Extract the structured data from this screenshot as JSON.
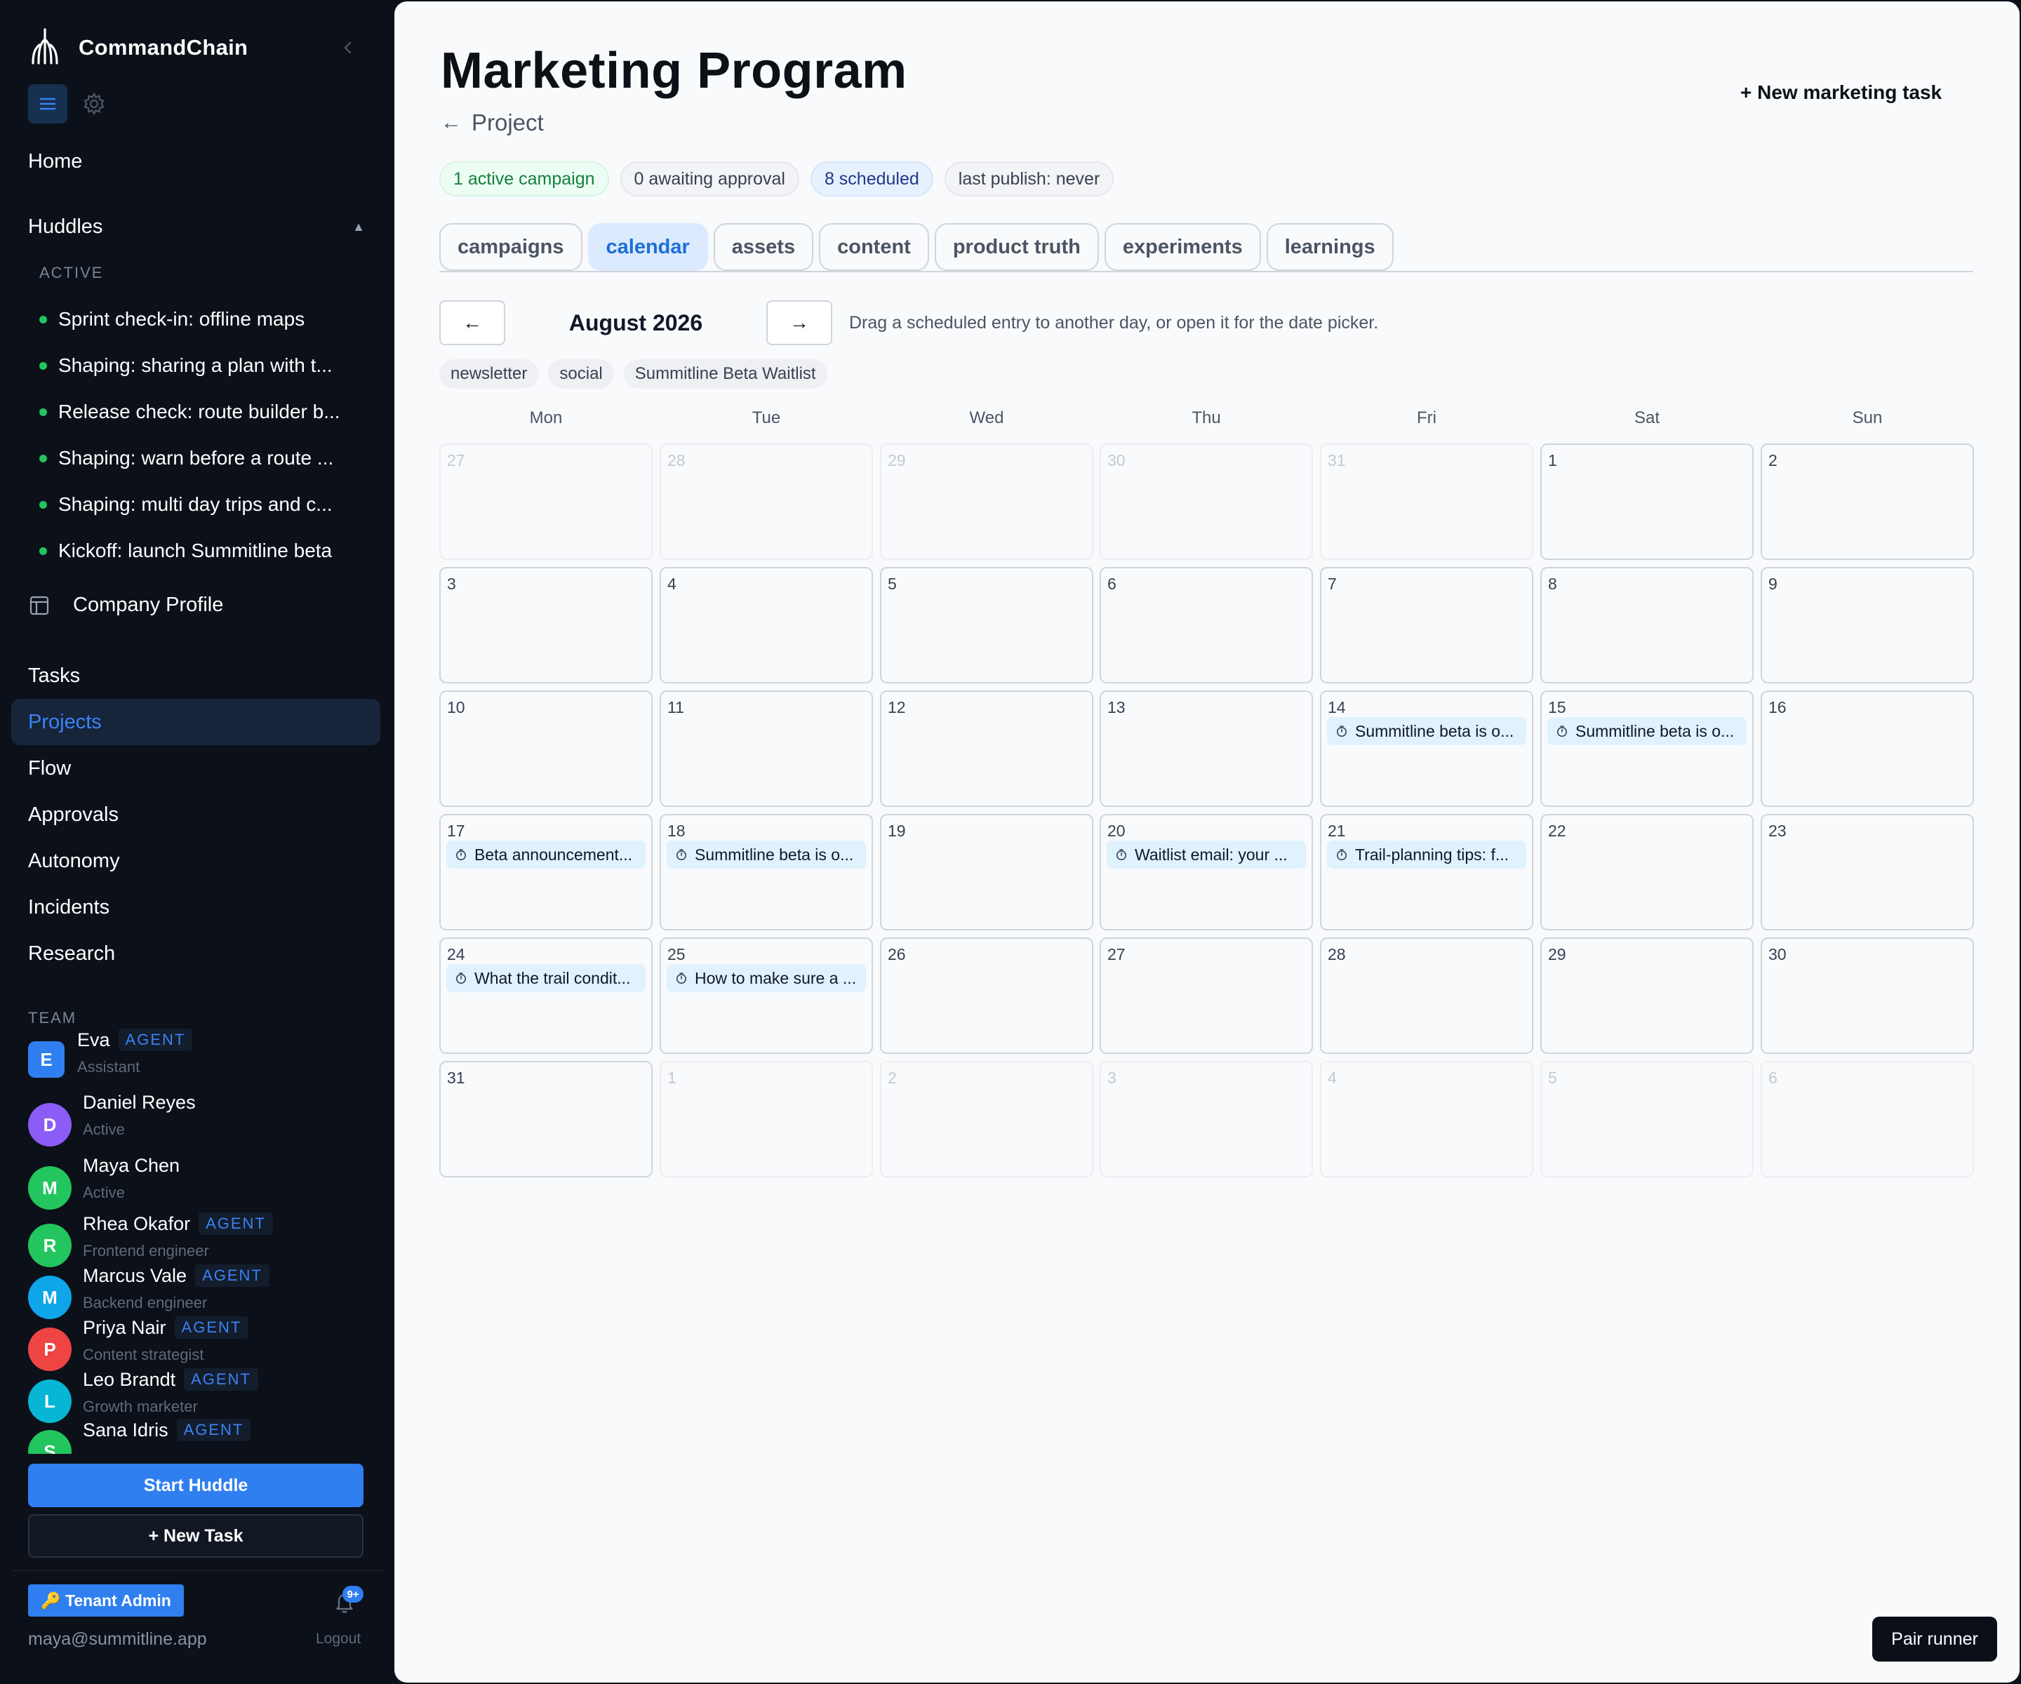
{
  "sidebar": {
    "brand": "CommandChain",
    "nav_home": "Home",
    "huddles_label": "Huddles",
    "huddles_active_label": "ACTIVE",
    "huddles": [
      "Sprint check-in: offline maps",
      "Shaping: sharing a plan with t...",
      "Release check: route builder b...",
      "Shaping: warn before a route ...",
      "Shaping: multi day trips and c...",
      "Kickoff: launch Summitline beta"
    ],
    "company_profile": "Company Profile",
    "nav": [
      "Tasks",
      "Projects",
      "Flow",
      "Approvals",
      "Autonomy",
      "Incidents",
      "Research"
    ],
    "active_nav": "Projects",
    "team_label": "TEAM",
    "team": [
      {
        "initial": "E",
        "name": "Eva",
        "agent": "AGENT",
        "role": "Assistant",
        "color": "#2f7ff0"
      },
      {
        "initial": "D",
        "name": "Daniel Reyes",
        "agent": "",
        "role": "Active",
        "color": "#8b5cf6"
      },
      {
        "initial": "M",
        "name": "Maya Chen",
        "agent": "",
        "role": "Active",
        "color": "#22c55e"
      },
      {
        "initial": "R",
        "name": "Rhea Okafor",
        "agent": "AGENT",
        "role": "Frontend engineer",
        "color": "#22c55e"
      },
      {
        "initial": "M",
        "name": "Marcus Vale",
        "agent": "AGENT",
        "role": "Backend engineer",
        "color": "#0ea5e9"
      },
      {
        "initial": "P",
        "name": "Priya Nair",
        "agent": "AGENT",
        "role": "Content strategist",
        "color": "#ef4444"
      },
      {
        "initial": "L",
        "name": "Leo Brandt",
        "agent": "AGENT",
        "role": "Growth marketer",
        "color": "#06b6d4"
      },
      {
        "initial": "S",
        "name": "Sana Idris",
        "agent": "AGENT",
        "role": "",
        "color": "#22c55e"
      }
    ],
    "start_huddle": "Start Huddle",
    "new_task": "+ New Task",
    "tenant_badge": "🔑 Tenant Admin",
    "notification_count": "9+",
    "user_email": "maya@summitline.app",
    "logout": "Logout"
  },
  "main": {
    "title": "Marketing Program",
    "back_label": "Project",
    "back_arrow": "←",
    "new_task": "+ New marketing task",
    "status_pills": [
      {
        "label": "1 active campaign",
        "tone": "green"
      },
      {
        "label": "0 awaiting approval",
        "tone": "gray"
      },
      {
        "label": "8 scheduled",
        "tone": "blue"
      },
      {
        "label": "last publish: never",
        "tone": "gray"
      }
    ],
    "tabs": [
      "campaigns",
      "calendar",
      "assets",
      "content",
      "product truth",
      "experiments",
      "learnings"
    ],
    "active_tab": "calendar",
    "calendar": {
      "prev": "←",
      "next": "→",
      "month": "August 2026",
      "hint": "Drag a scheduled entry to another day, or open it for the date picker.",
      "filters": [
        "newsletter",
        "social",
        "Summitline Beta Waitlist"
      ],
      "weekdays": [
        "Mon",
        "Tue",
        "Wed",
        "Thu",
        "Fri",
        "Sat",
        "Sun"
      ],
      "weeks": [
        [
          {
            "d": "27",
            "m": true
          },
          {
            "d": "28",
            "m": true
          },
          {
            "d": "29",
            "m": true
          },
          {
            "d": "30",
            "m": true
          },
          {
            "d": "31",
            "m": true
          },
          {
            "d": "1"
          },
          {
            "d": "2"
          }
        ],
        [
          {
            "d": "3"
          },
          {
            "d": "4"
          },
          {
            "d": "5"
          },
          {
            "d": "6"
          },
          {
            "d": "7"
          },
          {
            "d": "8"
          },
          {
            "d": "9"
          }
        ],
        [
          {
            "d": "10"
          },
          {
            "d": "11"
          },
          {
            "d": "12"
          },
          {
            "d": "13"
          },
          {
            "d": "14",
            "e": "Summitline beta is o..."
          },
          {
            "d": "15",
            "e": "Summitline beta is o..."
          },
          {
            "d": "16"
          }
        ],
        [
          {
            "d": "17",
            "e": "Beta announcement..."
          },
          {
            "d": "18",
            "e": "Summitline beta is o..."
          },
          {
            "d": "19"
          },
          {
            "d": "20",
            "e": "Waitlist email: your ..."
          },
          {
            "d": "21",
            "e": "Trail-planning tips: f..."
          },
          {
            "d": "22"
          },
          {
            "d": "23"
          }
        ],
        [
          {
            "d": "24",
            "e": "What the trail condit..."
          },
          {
            "d": "25",
            "e": "How to make sure a ..."
          },
          {
            "d": "26"
          },
          {
            "d": "27"
          },
          {
            "d": "28"
          },
          {
            "d": "29"
          },
          {
            "d": "30"
          }
        ],
        [
          {
            "d": "31"
          },
          {
            "d": "1",
            "m": true
          },
          {
            "d": "2",
            "m": true
          },
          {
            "d": "3",
            "m": true
          },
          {
            "d": "4",
            "m": true
          },
          {
            "d": "5",
            "m": true
          },
          {
            "d": "6",
            "m": true
          }
        ]
      ]
    }
  },
  "pair_runner": "Pair runner",
  "colors": {
    "accent": "#2f7ff0",
    "sidebar_bg": "#0b1019",
    "event_bg": "#e0f2fe",
    "active_dot": "#22c55e"
  }
}
